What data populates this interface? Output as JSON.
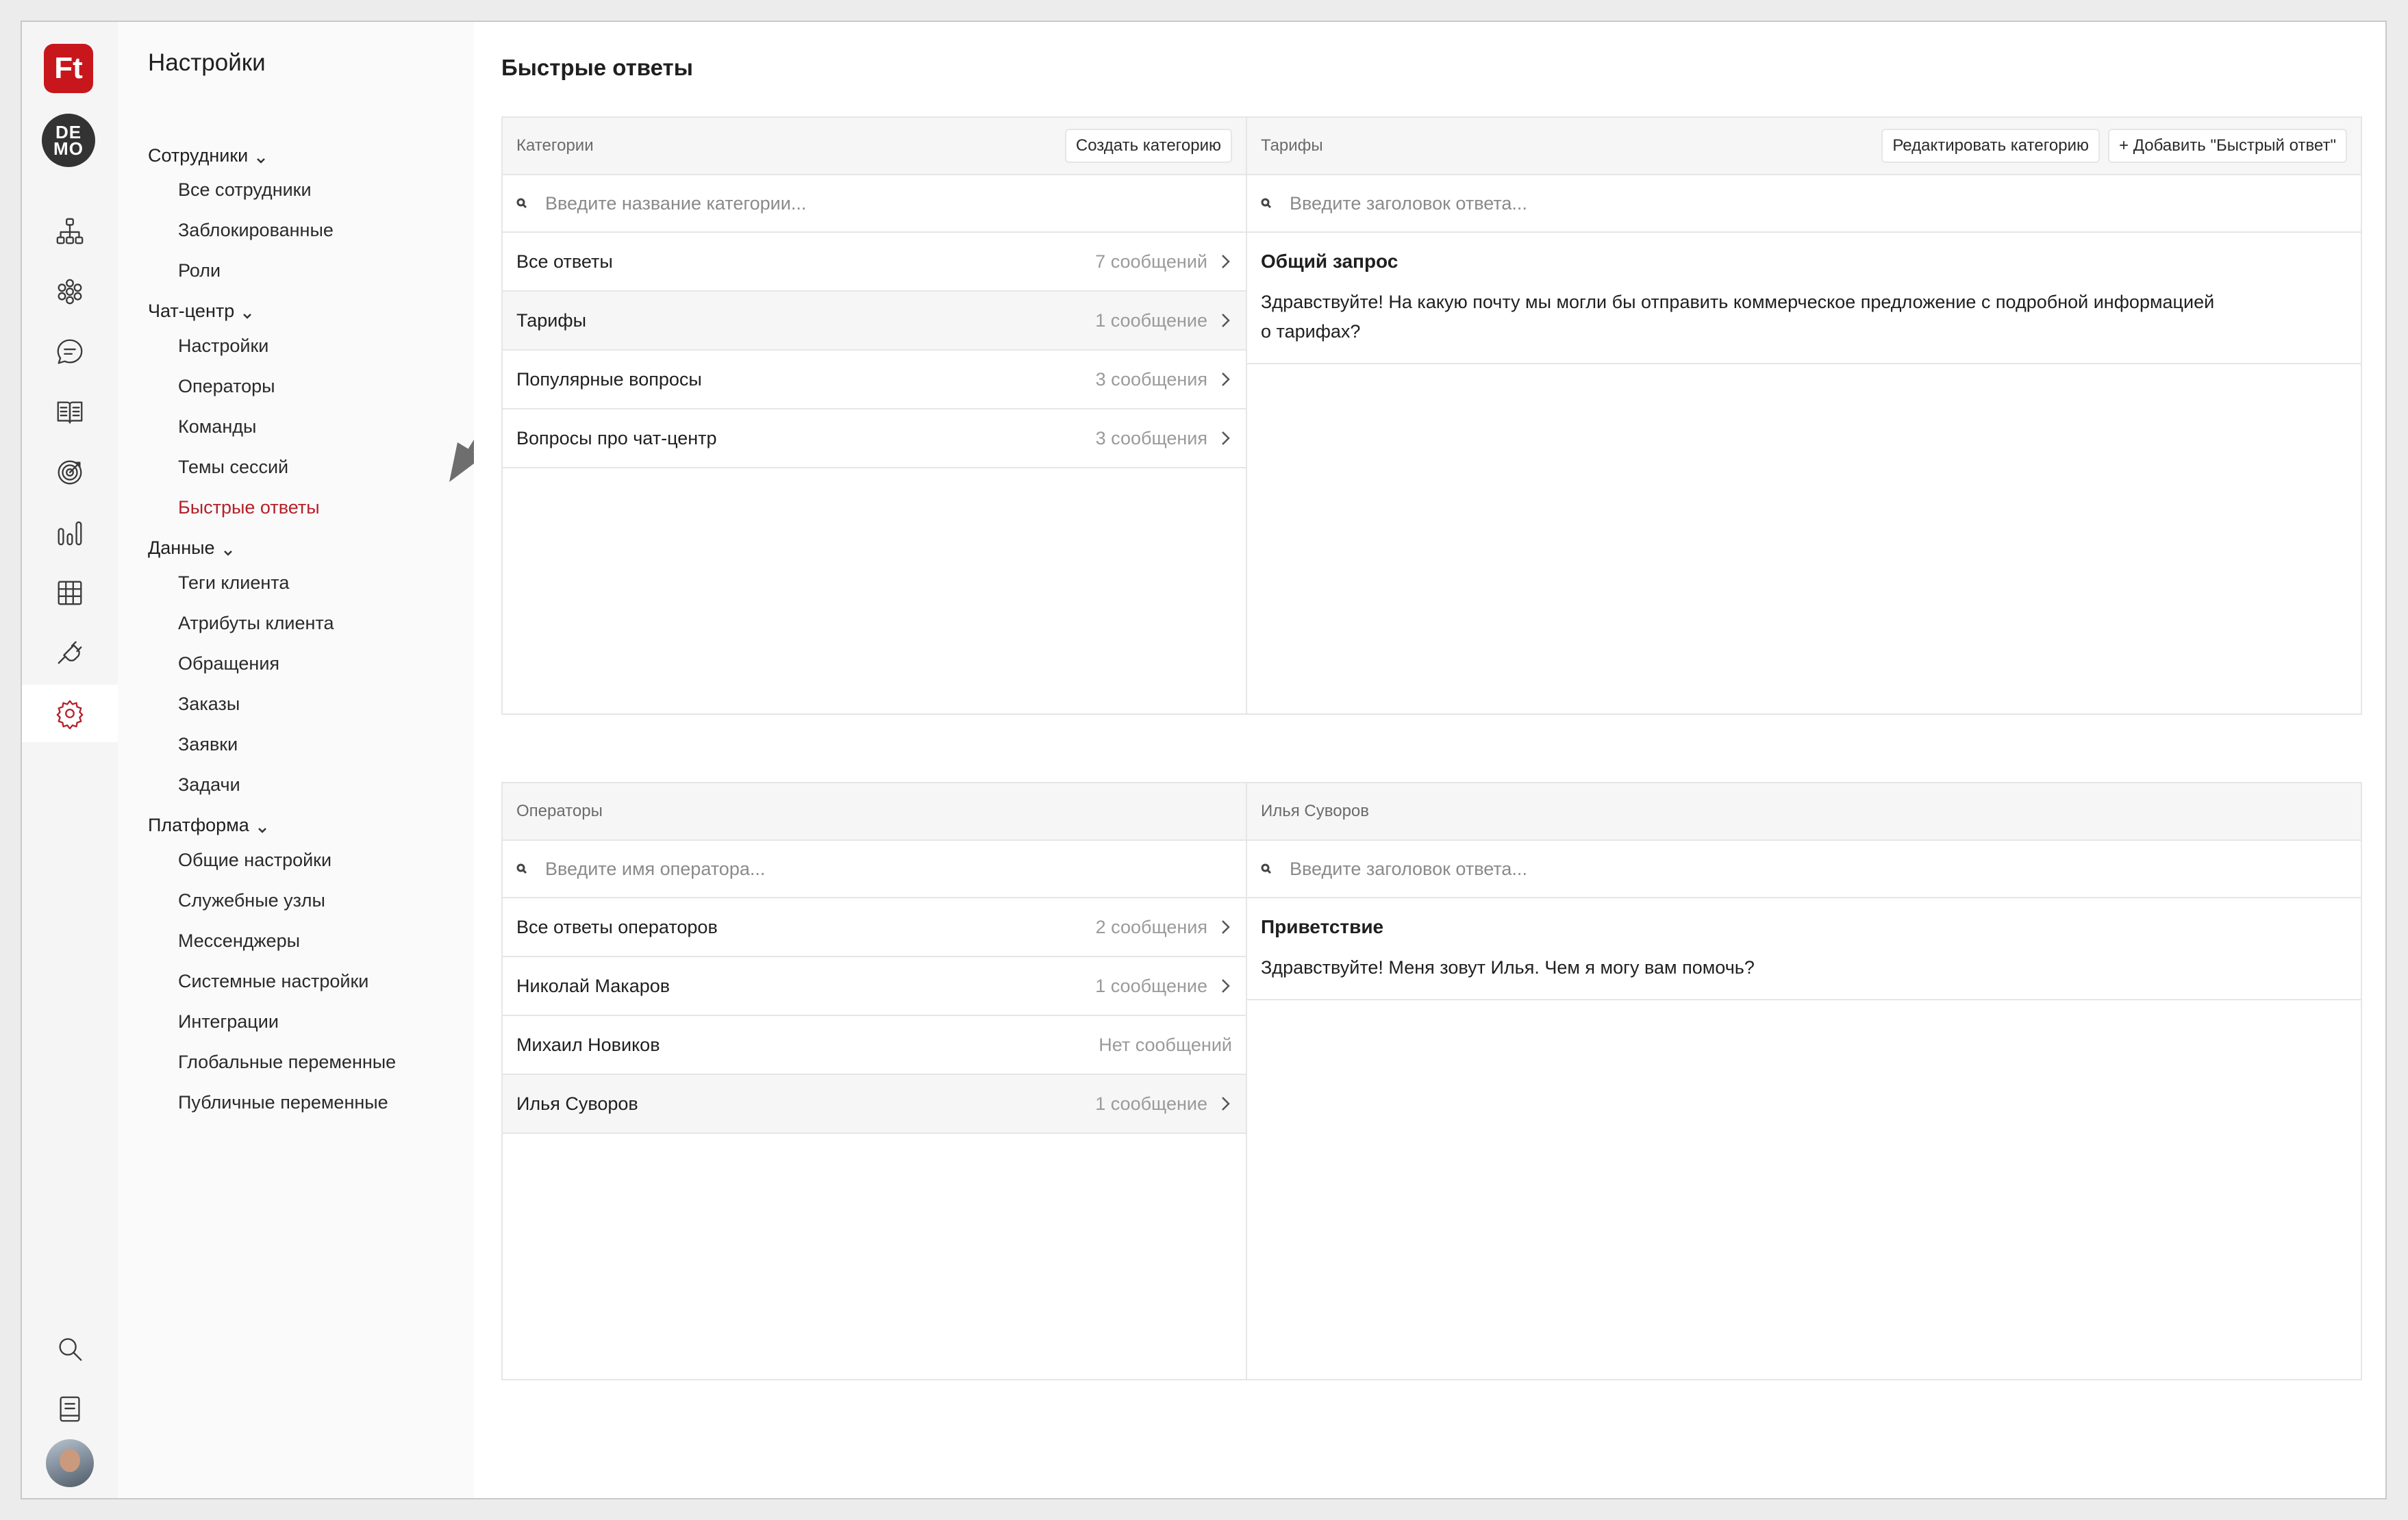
{
  "rail": {
    "logo_text": "Ft",
    "demo_line1": "DE",
    "demo_line2": "MO",
    "icons": [
      "org-structure-icon",
      "flower-icon",
      "chat-bubble-icon",
      "book-icon",
      "target-icon",
      "bar-chart-icon",
      "grid-table-icon",
      "plug-icon",
      "gear-icon"
    ],
    "bottom_icons": [
      "search-icon",
      "notebook-icon"
    ],
    "active": "gear-icon",
    "accent_color": "#b5202a",
    "logo_color": "#c8161d"
  },
  "sidebar": {
    "title": "Настройки",
    "groups": [
      {
        "label": "Сотрудники",
        "items": [
          "Все сотрудники",
          "Заблокированные",
          "Роли"
        ]
      },
      {
        "label": "Чат-центр",
        "items": [
          "Настройки",
          "Операторы",
          "Команды",
          "Темы сессий",
          "Быстрые ответы"
        ]
      },
      {
        "label": "Данные",
        "items": [
          "Теги клиента",
          "Атрибуты клиента",
          "Обращения",
          "Заказы",
          "Заявки",
          "Задачи"
        ]
      },
      {
        "label": "Платформа",
        "items": [
          "Общие настройки",
          "Служебные узлы",
          "Мессенджеры",
          "Системные настройки",
          "Интеграции",
          "Глобальные переменные",
          "Публичные переменные"
        ]
      }
    ],
    "active_item": "Быстрые ответы"
  },
  "main": {
    "title": "Быстрые ответы",
    "categories_panel": {
      "left_header": "Категории",
      "create_button": "Создать категорию",
      "left_search_placeholder": "Введите название категории...",
      "rows": [
        {
          "name": "Все ответы",
          "count": "7 сообщений"
        },
        {
          "name": "Тарифы",
          "count": "1 сообщение"
        },
        {
          "name": "Популярные вопросы",
          "count": "3 сообщения"
        },
        {
          "name": "Вопросы про чат-центр",
          "count": "3 сообщения"
        }
      ],
      "selected_row": "Тарифы",
      "right_header": "Тарифы",
      "edit_button": "Редактировать категорию",
      "add_button": "+ Добавить \"Быстрый ответ\"",
      "right_search_placeholder": "Введите заголовок ответа...",
      "answer": {
        "title": "Общий запрос",
        "body": "Здравствуйте! На какую почту мы могли бы отправить коммерческое предложение с подробной информацией о тарифах?"
      }
    },
    "operators_panel": {
      "left_header": "Операторы",
      "left_search_placeholder": "Введите имя оператора...",
      "rows": [
        {
          "name": "Все ответы операторов",
          "count": "2 сообщения"
        },
        {
          "name": "Николай Макаров",
          "count": "1 сообщение"
        },
        {
          "name": "Михаил Новиков",
          "count": "Нет сообщений"
        },
        {
          "name": "Илья Суворов",
          "count": "1 сообщение"
        }
      ],
      "selected_row": "Илья Суворов",
      "right_header": "Илья Суворов",
      "right_search_placeholder": "Введите заголовок ответа...",
      "answer": {
        "title": "Приветствие",
        "body": "Здравствуйте! Меня зовут Илья. Чем я могу вам помочь?"
      }
    }
  }
}
